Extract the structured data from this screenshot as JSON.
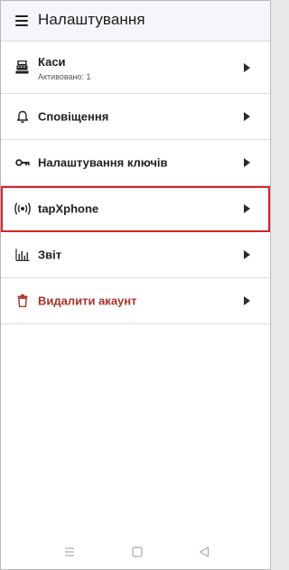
{
  "app_bar": {
    "title": "Налаштування",
    "menu_icon": "hamburger-menu-icon"
  },
  "items": [
    {
      "label": "Каси",
      "sublabel": "Активовано: 1",
      "icon": "cash-register-icon"
    },
    {
      "label": "Сповіщення",
      "icon": "bell-icon"
    },
    {
      "label": "Налаштування ключів",
      "icon": "key-icon"
    },
    {
      "label": "tapXphone",
      "icon": "contactless-signal-icon",
      "highlighted": true
    },
    {
      "label": "Звіт",
      "icon": "bar-chart-icon"
    },
    {
      "label": "Видалити акаунт",
      "icon": "trash-icon",
      "color": "#a8322c"
    }
  ],
  "colors": {
    "highlight_border": "#d6262b",
    "danger": "#a8322c",
    "app_bar_bg": "#f4f6fb"
  },
  "nav_bar": {
    "buttons": [
      "recents-icon",
      "home-icon",
      "back-icon"
    ]
  }
}
